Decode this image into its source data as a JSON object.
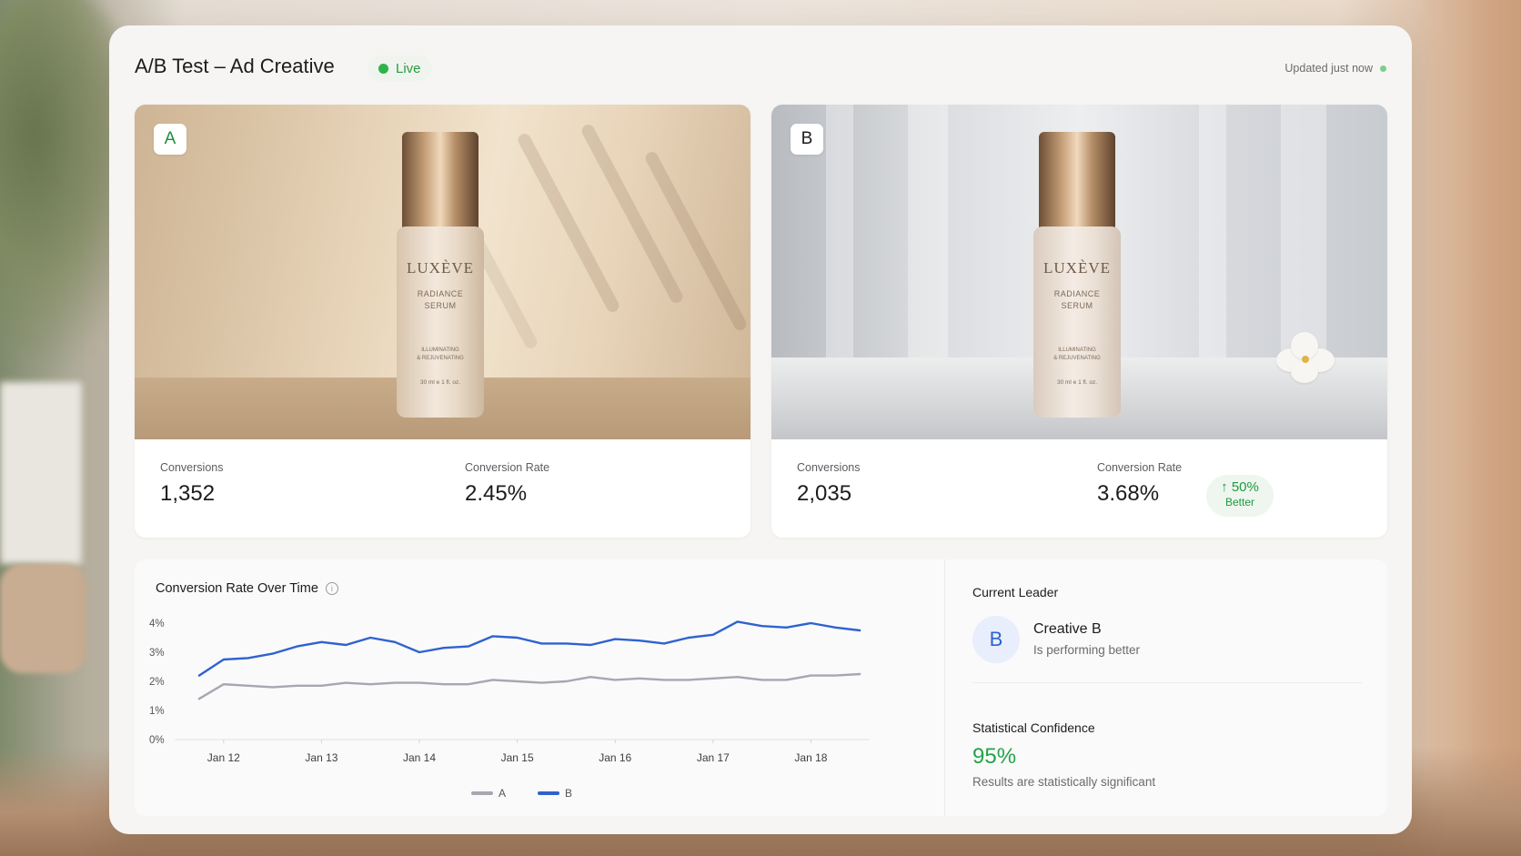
{
  "header": {
    "title": "A/B Test – Ad Creative",
    "status": "Live",
    "updated": "Updated just now"
  },
  "variants": [
    {
      "badge": "A",
      "product": {
        "brand": "LUXÈVE",
        "line1": "RADIANCE",
        "line2": "SERUM",
        "line3": "ILLUMINATING",
        "line4": "& REJUVENATING",
        "size": "30 ml e 1 fl. oz."
      },
      "conversions_label": "Conversions",
      "conversions": "1,352",
      "rate_label": "Conversion Rate",
      "rate": "2.45%"
    },
    {
      "badge": "B",
      "product": {
        "brand": "LUXÈVE",
        "line1": "RADIANCE",
        "line2": "SERUM",
        "line3": "ILLUMINATING",
        "line4": "& REJUVENATING",
        "size": "30 ml e 1 fl. oz."
      },
      "conversions_label": "Conversions",
      "conversions": "2,035",
      "rate_label": "Conversion Rate",
      "rate": "3.68%",
      "uplift": "50%",
      "uplift_label": "Better"
    }
  ],
  "chart": {
    "title": "Conversion Rate Over Time"
  },
  "chart_data": {
    "type": "line",
    "title": "Conversion Rate Over Time",
    "xlabel": "",
    "ylabel": "",
    "y_ticks": [
      "0%",
      "1%",
      "2%",
      "3%",
      "4%"
    ],
    "ylim": [
      0,
      4
    ],
    "x_ticks": [
      "Jan 12",
      "Jan 13",
      "Jan 14",
      "Jan 15",
      "Jan 16",
      "Jan 17",
      "Jan 18"
    ],
    "x": [
      11.75,
      12,
      12.25,
      12.5,
      12.75,
      13,
      13.25,
      13.5,
      13.75,
      14,
      14.25,
      14.5,
      14.75,
      15,
      15.25,
      15.5,
      15.75,
      16,
      16.25,
      16.5,
      16.75,
      17,
      17.25,
      17.5,
      17.75,
      18,
      18.25,
      18.5
    ],
    "xlim": [
      11.5,
      18.6
    ],
    "series": [
      {
        "name": "A",
        "color": "#a6a7b0",
        "values": [
          1.4,
          1.9,
          1.85,
          1.8,
          1.85,
          1.85,
          1.95,
          1.9,
          1.95,
          1.95,
          1.9,
          1.9,
          2.05,
          2.0,
          1.95,
          2.0,
          2.15,
          2.05,
          2.1,
          2.05,
          2.05,
          2.1,
          2.15,
          2.05,
          2.05,
          2.2,
          2.2,
          2.25
        ]
      },
      {
        "name": "B",
        "color": "#2f62d0",
        "values": [
          2.2,
          2.75,
          2.8,
          2.95,
          3.2,
          3.35,
          3.25,
          3.5,
          3.35,
          3.0,
          3.15,
          3.2,
          3.55,
          3.5,
          3.3,
          3.3,
          3.25,
          3.45,
          3.4,
          3.3,
          3.5,
          3.6,
          4.05,
          3.9,
          3.85,
          4.0,
          3.85,
          3.75
        ]
      }
    ],
    "legend": "bottom-center",
    "grid": false
  },
  "leader": {
    "title": "Current Leader",
    "avatar": "B",
    "name": "Creative B",
    "desc": "Is performing better"
  },
  "confidence": {
    "title": "Statistical Confidence",
    "value": "95%",
    "desc": "Results are statistically significant"
  },
  "colors": {
    "live": "#2eb34a",
    "accent": "#2f62d0",
    "success": "#22a447"
  },
  "icons": {
    "info": "info-icon",
    "up_arrow": "arrow-up-icon",
    "status": "status-dot-icon"
  }
}
